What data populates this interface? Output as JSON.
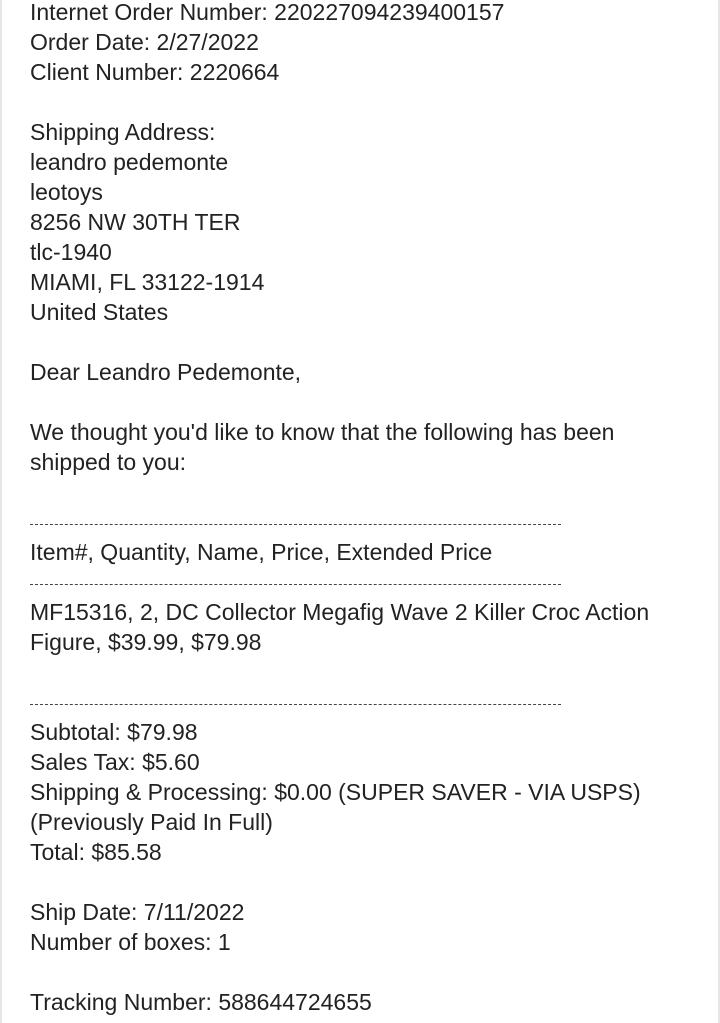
{
  "order": {
    "internet_order_number": "Internet Order Number: 220227094239400157",
    "order_date": "Order Date: 2/27/2022",
    "client_number": "Client Number: 2220664"
  },
  "shipping": {
    "heading": "Shipping Address:",
    "name": "leandro pedemonte",
    "company": "leotoys",
    "street": "8256 NW 30TH TER",
    "line2": "tlc-1940",
    "city_state_zip": "MIAMI, FL 33122-1914",
    "country": "United States"
  },
  "greeting": "Dear Leandro Pedemonte,",
  "intro": "We thought you'd like to know that the following has been shipped to you:",
  "items_table": {
    "header": "Item#,  Quantity,  Name,  Price,  Extended Price",
    "rows": [
      "MF15316,  2,  DC Collector Megafig Wave 2 Killer Croc Action Figure,  $39.99,  $79.98"
    ]
  },
  "totals": {
    "subtotal": "Subtotal: $79.98",
    "sales_tax": "Sales Tax:  $5.60",
    "shipping": "Shipping & Processing: $0.00 (SUPER SAVER - VIA USPS)",
    "shipping_note": "(Previously Paid In Full)",
    "total": "Total: $85.58"
  },
  "shipment": {
    "ship_date": "Ship Date: 7/11/2022",
    "boxes": "Number of boxes: 1",
    "tracking": "Tracking Number: 588644724655"
  },
  "colors": {
    "text": "#222222",
    "link": "#1a0dab",
    "background": "#ffffff"
  }
}
